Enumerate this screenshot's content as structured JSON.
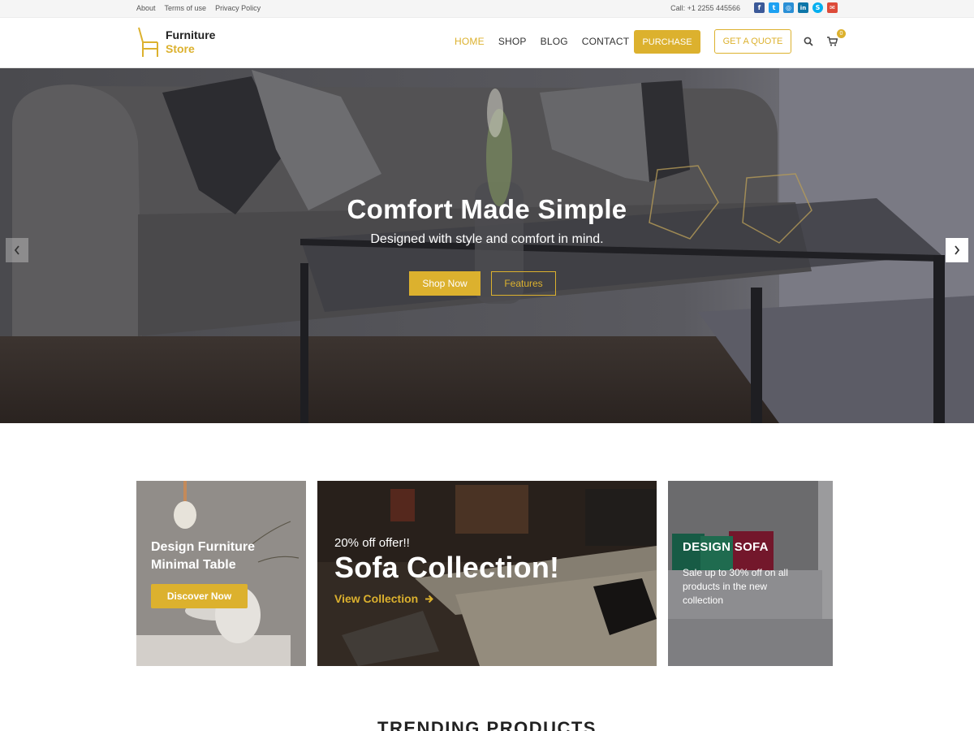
{
  "topbar": {
    "links": [
      "About",
      "Terms of use",
      "Privacy Policy"
    ],
    "call": "Call: +1 2255 445566",
    "social_icons": [
      {
        "name": "facebook-icon",
        "glyph": "f",
        "color": "#3b5998"
      },
      {
        "name": "twitter-icon",
        "glyph": "t",
        "color": "#1da1f2"
      },
      {
        "name": "instagram-icon",
        "glyph": "◎",
        "color": "#2a8fd6"
      },
      {
        "name": "linkedin-icon",
        "glyph": "in",
        "color": "#0e76a8"
      },
      {
        "name": "skype-icon",
        "glyph": "S",
        "color": "#00aff0"
      },
      {
        "name": "email-icon",
        "glyph": "✉",
        "color": "#dd4b39"
      }
    ]
  },
  "header": {
    "logo_line1": "Furniture",
    "logo_line2": "Store",
    "nav": [
      {
        "label": "HOME",
        "active": true
      },
      {
        "label": "SHOP",
        "active": false
      },
      {
        "label": "BLOG",
        "active": false
      },
      {
        "label": "CONTACT",
        "active": false
      }
    ],
    "purchase_label": "PURCHASE",
    "quote_label": "GET A QUOTE",
    "cart_count": "0"
  },
  "hero": {
    "title": "Comfort Made Simple",
    "subtitle": "Designed with style and comfort in mind.",
    "shop_label": "Shop Now",
    "features_label": "Features"
  },
  "promos": {
    "card1": {
      "title_line1": "Design Furniture",
      "title_line2": "Minimal Table",
      "button": "Discover Now"
    },
    "card2": {
      "offer": "20% off offer!!",
      "title": "Sofa Collection!",
      "link": "View Collection"
    },
    "card3": {
      "title": "DESIGN SOFA",
      "text": "Sale up to 30% off on all products in the new collection"
    }
  },
  "section": {
    "title": "TRENDING PRODUCTS"
  },
  "colors": {
    "accent": "#dcb12e",
    "text": "#222222"
  }
}
